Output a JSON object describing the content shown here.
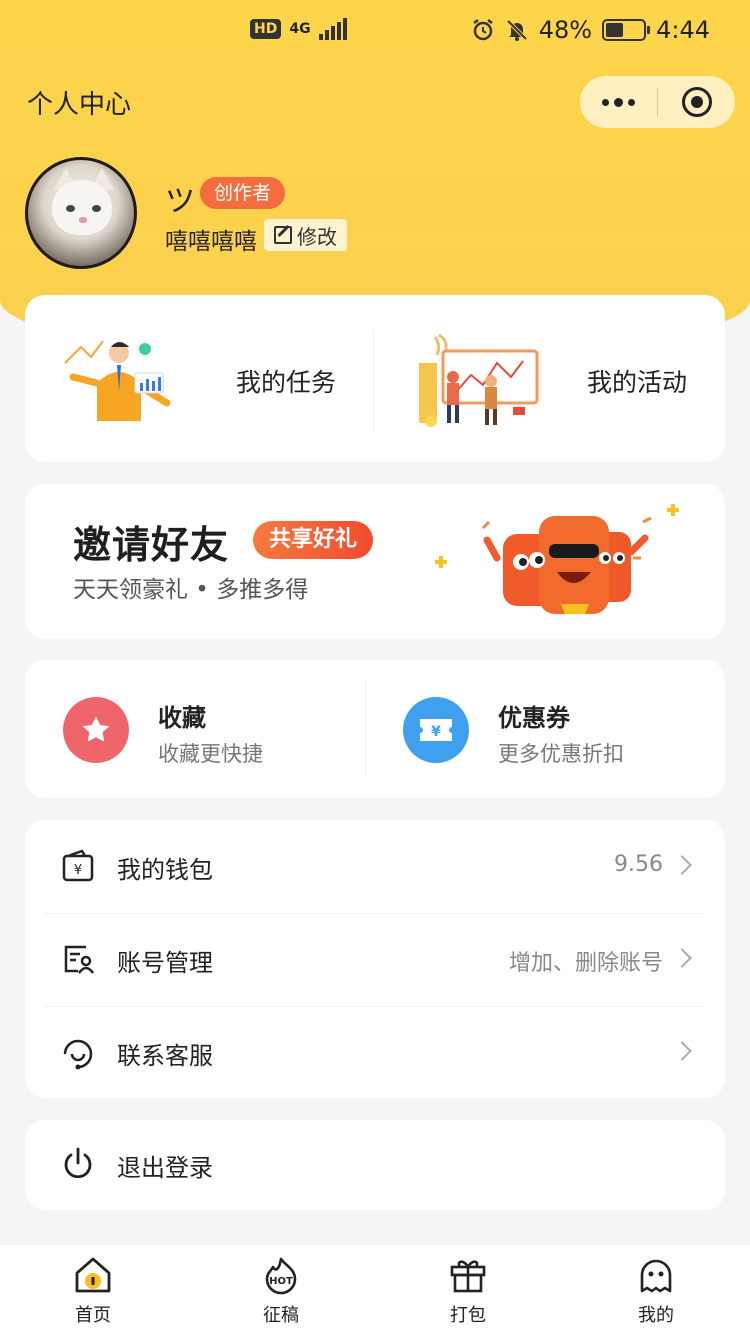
{
  "status_bar": {
    "network_badge": "HD",
    "network_type": "4G",
    "battery_percent": "48%",
    "battery_level": 0.48,
    "time": "4:44"
  },
  "nav": {
    "title": "个人中心"
  },
  "profile": {
    "username": "ツ",
    "role_badge": "创作者",
    "nickname": "嘻嘻嘻嘻",
    "edit_label": "修改"
  },
  "quick_actions": [
    {
      "label": "我的任务"
    },
    {
      "label": "我的活动"
    }
  ],
  "banner": {
    "title": "邀请好友",
    "pill": "共享好礼",
    "subtitle": "天天领豪礼 • 多推多得"
  },
  "features": [
    {
      "title": "收藏",
      "subtitle": "收藏更快捷",
      "color": "#f0656a"
    },
    {
      "title": "优惠券",
      "subtitle": "更多优惠折扣",
      "color": "#3fa0ef"
    }
  ],
  "menu": [
    {
      "label": "我的钱包",
      "value": "9.56"
    },
    {
      "label": "账号管理",
      "value": "增加、删除账号"
    },
    {
      "label": "联系客服",
      "value": ""
    }
  ],
  "logout": {
    "label": "退出登录"
  },
  "tabbar": [
    {
      "label": "首页"
    },
    {
      "label": "征稿"
    },
    {
      "label": "打包"
    },
    {
      "label": "我的"
    }
  ],
  "colors": {
    "brand_yellow": "#fdd54a",
    "badge_orange": "#f46d3e"
  }
}
